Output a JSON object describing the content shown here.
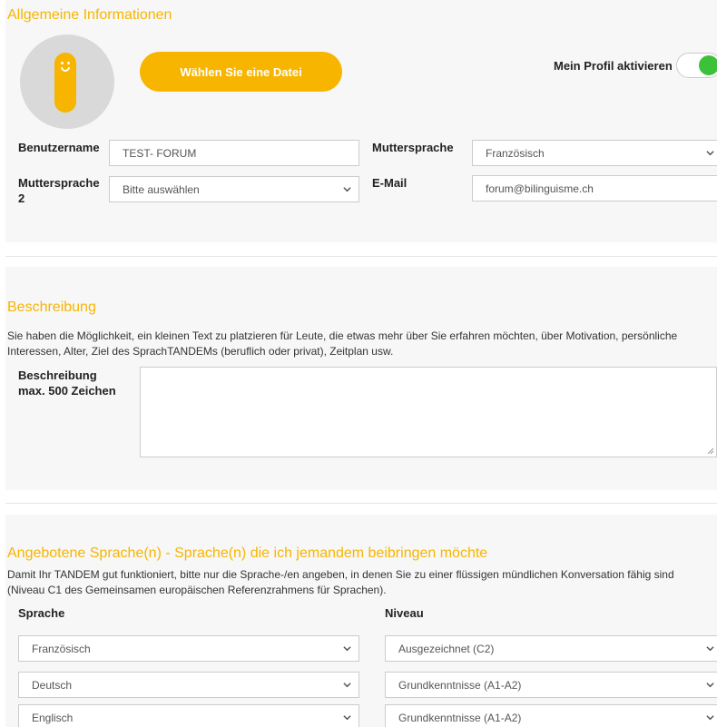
{
  "general": {
    "title": "Allgemeine Informationen",
    "file_button_label": "Wählen Sie eine Datei",
    "toggle_label": "Mein Profil aktivieren",
    "toggle_on": true,
    "username_label": "Benutzername",
    "username_value": "TEST- FORUM",
    "mother_tongue_label": "Muttersprache",
    "mother_tongue_value": "Französisch",
    "mother_tongue2_label_line1": "Muttersprache",
    "mother_tongue2_label_line2": "2",
    "mother_tongue2_value": "Bitte auswählen",
    "email_label": "E-Mail",
    "email_value": "forum@bilinguisme.ch"
  },
  "description": {
    "title": "Beschreibung",
    "text": "Sie haben die Möglichkeit, ein kleinen Text zu platzieren für Leute, die etwas mehr über Sie erfahren möchten, über Motivation, persönliche Interessen, Alter, Ziel des SprachTANDEMs (beruflich oder privat), Zeitplan usw.",
    "field_label_line1": "Beschreibung",
    "field_label_line2": "max. 500 Zeichen",
    "field_value": ""
  },
  "offered": {
    "title": "Angebotene Sprache(n) - Sprache(n) die ich jemandem beibringen möchte",
    "text": "Damit Ihr TANDEM gut funktioniert, bitte nur die Sprache-/en angeben, in denen Sie zu einer flüssigen mündlichen Konversation fähig sind (Niveau C1 des Gemeinsamen europäischen Referenzrahmens für Sprachen).",
    "language_header": "Sprache",
    "level_header": "Niveau",
    "rows": [
      {
        "language": "Französisch",
        "level": "Ausgezeichnet (C2)"
      },
      {
        "language": "Deutsch",
        "level": "Grundkenntnisse (A1-A2)"
      },
      {
        "language": "Englisch",
        "level": "Grundkenntnisse (A1-A2)"
      }
    ]
  },
  "colors": {
    "accent": "#f7b500",
    "toggle_on": "#3cc13b",
    "panel_bg": "#f7f7f7"
  }
}
